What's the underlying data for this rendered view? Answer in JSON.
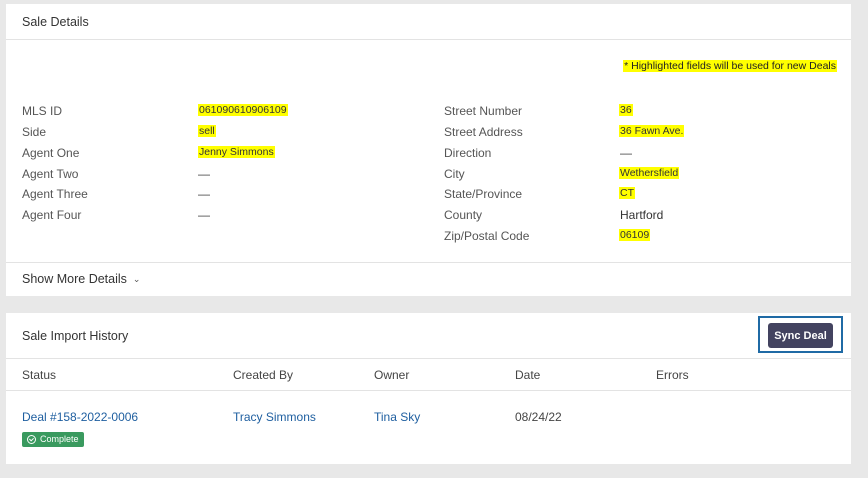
{
  "sale_details": {
    "title": "Sale Details",
    "note": "* Highlighted fields will be used for new Deals",
    "left_fields": [
      {
        "label": "MLS ID",
        "value": "061090610906109",
        "highlighted": true
      },
      {
        "label": "Side",
        "value": "sell",
        "highlighted": true
      },
      {
        "label": "Agent One",
        "value": "Jenny Simmons",
        "highlighted": true
      },
      {
        "label": "Agent Two",
        "value": "—",
        "highlighted": false
      },
      {
        "label": "Agent Three",
        "value": "—",
        "highlighted": false
      },
      {
        "label": "Agent Four",
        "value": "—",
        "highlighted": false
      }
    ],
    "right_fields": [
      {
        "label": "Street Number",
        "value": "36",
        "highlighted": true
      },
      {
        "label": "Street Address",
        "value": "36 Fawn Ave.",
        "highlighted": true
      },
      {
        "label": "Direction",
        "value": "—",
        "highlighted": false
      },
      {
        "label": "City",
        "value": "Wethersfield",
        "highlighted": true
      },
      {
        "label": "State/Province",
        "value": "CT",
        "highlighted": true
      },
      {
        "label": "County",
        "value": "Hartford",
        "highlighted": false
      },
      {
        "label": "Zip/Postal Code",
        "value": "06109",
        "highlighted": true
      }
    ],
    "show_more_label": "Show More Details"
  },
  "import_history": {
    "title": "Sale Import History",
    "sync_button_label": "Sync Deal",
    "columns": [
      "Status",
      "Created By",
      "Owner",
      "Date",
      "Errors"
    ],
    "rows": [
      {
        "status": "Deal #158-2022-0006",
        "badge": "Complete",
        "created_by": "Tracy Simmons",
        "owner": "Tina Sky",
        "date": "08/24/22",
        "errors": ""
      }
    ]
  },
  "colors": {
    "highlight": "#ffff00",
    "link": "#1f5fa0",
    "button": "#434360",
    "badge": "#3a9a5f",
    "focus_outline": "#1f6aa5"
  }
}
